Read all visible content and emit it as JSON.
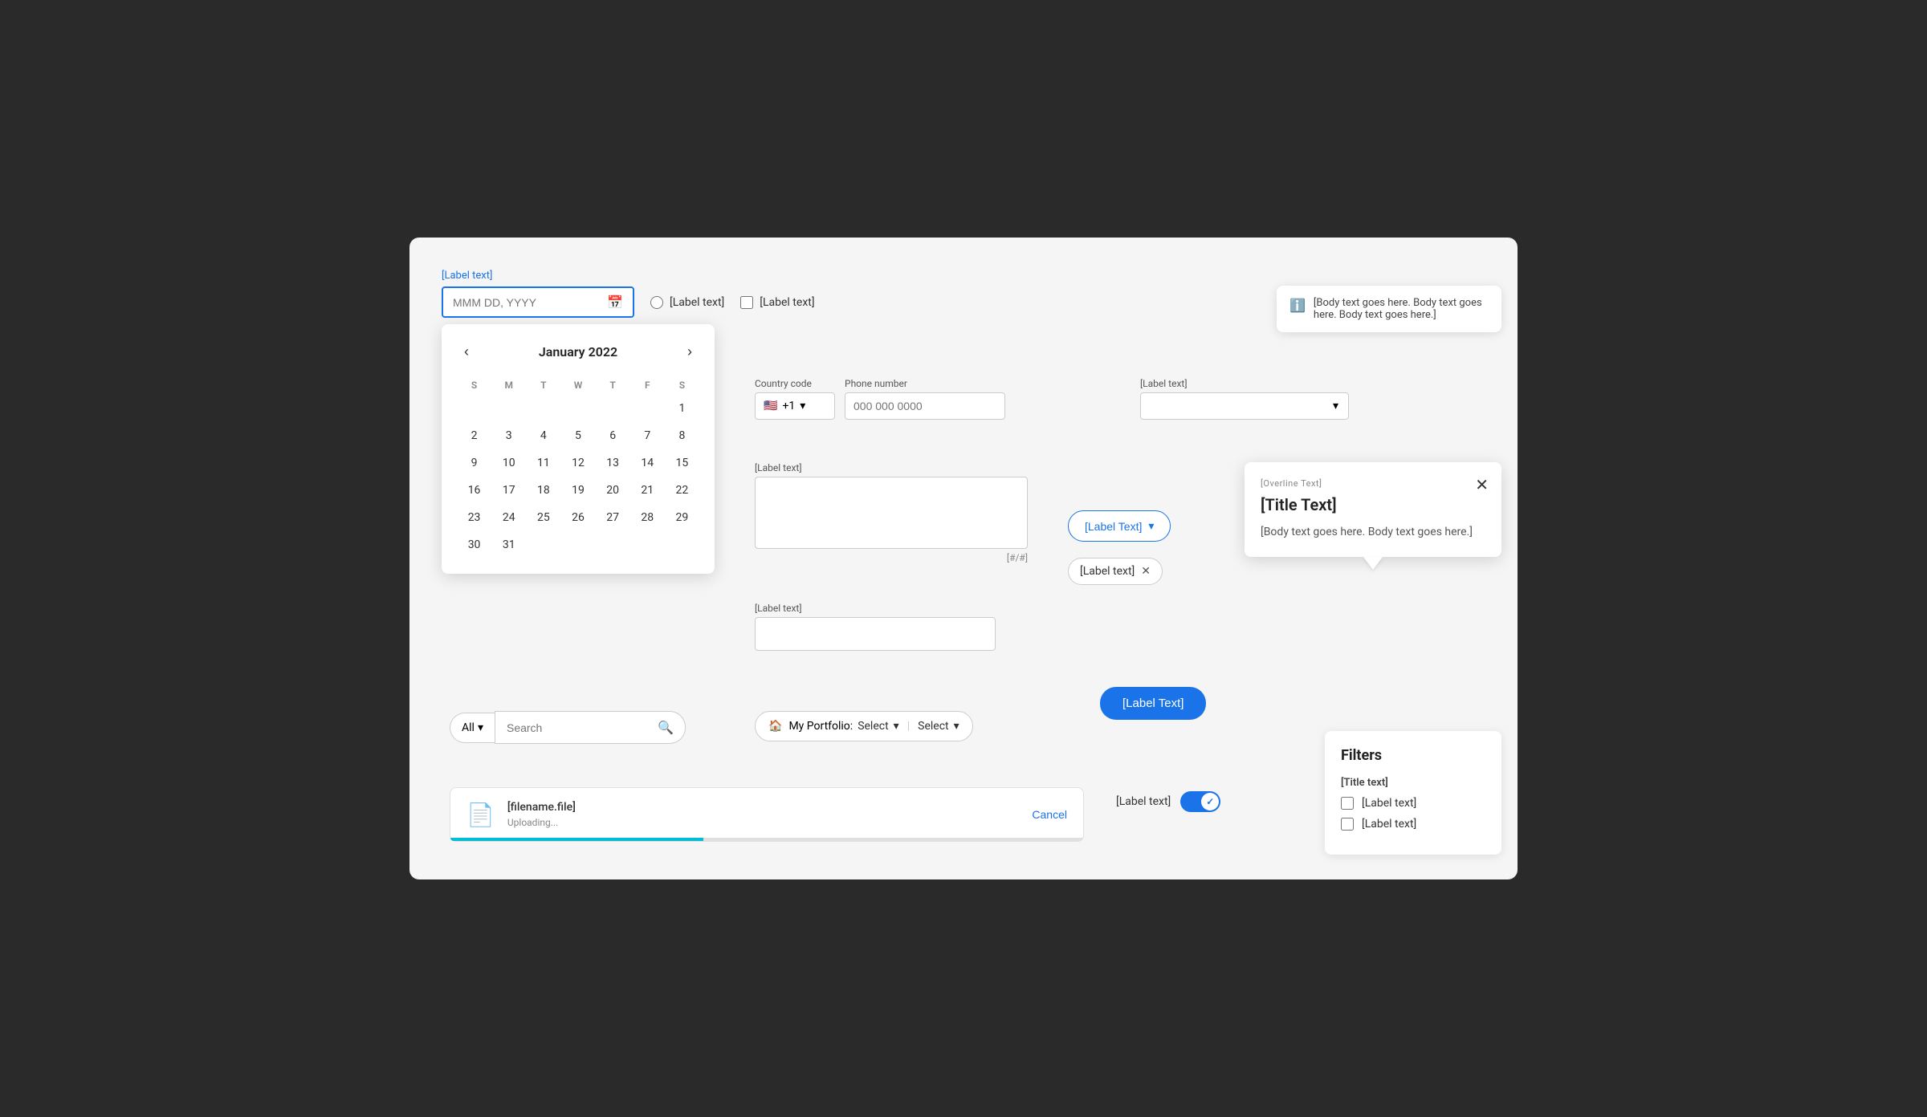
{
  "date": {
    "label": "[Label text]",
    "placeholder": "MMM DD, YYYY",
    "month_title": "January 2022",
    "days_of_week": [
      "S",
      "M",
      "T",
      "W",
      "T",
      "F",
      "S"
    ],
    "weeks": [
      [
        "",
        "",
        "",
        "",
        "",
        "",
        "1"
      ],
      [
        "2",
        "3",
        "4",
        "5",
        "6",
        "7",
        "8"
      ],
      [
        "9",
        "10",
        "11",
        "12",
        "13",
        "14",
        "15"
      ],
      [
        "16",
        "17",
        "18",
        "19",
        "20",
        "21",
        "22"
      ],
      [
        "23",
        "24",
        "25",
        "26",
        "27",
        "28",
        "29"
      ],
      [
        "30",
        "31",
        "",
        "",
        "",
        "",
        ""
      ]
    ]
  },
  "radio": {
    "label": "[Label text]"
  },
  "checkbox": {
    "label": "[Label text]"
  },
  "info_tooltip": {
    "text": "[Body text goes here. Body text goes here. Body text goes here.]"
  },
  "phone": {
    "country_code_label": "Country code",
    "phone_number_label": "Phone number",
    "country_flag": "🇺🇸",
    "country_code": "+1",
    "phone_placeholder": "000 000 0000"
  },
  "label_select": {
    "label": "[Label text]"
  },
  "textarea": {
    "label": "[Label text]",
    "char_count": "[#/#]"
  },
  "small_input": {
    "label": "[Label text]"
  },
  "dropdown_outlined_btn": {
    "label": "[Label Text]"
  },
  "tag_chip": {
    "label": "[Label text]"
  },
  "popover": {
    "overline": "[Overline Text]",
    "title": "[Title Text]",
    "body": "[Body text goes here. Body text goes here.]"
  },
  "primary_btn_right": {
    "label": "[Label Text]"
  },
  "search": {
    "all_label": "All",
    "placeholder": "Search"
  },
  "portfolio": {
    "home_label": "My Portfolio:",
    "select1": "Select",
    "select2": "Select"
  },
  "toggle": {
    "label": "[Label text]"
  },
  "file_upload": {
    "filename": "[filename.file]",
    "status": "Uploading...",
    "cancel_label": "Cancel"
  },
  "filters": {
    "title": "Filters",
    "group_title": "[Title text]",
    "items": [
      "[Label text]",
      "[Label text]"
    ]
  },
  "select_btn": {
    "label": "Select"
  }
}
